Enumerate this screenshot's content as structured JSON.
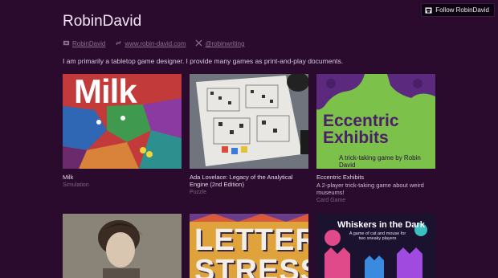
{
  "follow_button": {
    "label": "Follow RobinDavid",
    "icon": "follow-icon"
  },
  "profile": {
    "name": "RobinDavid",
    "links": [
      {
        "icon": "itchio-icon",
        "text": "RobinDavid"
      },
      {
        "icon": "link-icon",
        "text": "www.robin-david.com"
      },
      {
        "icon": "x-twitter-icon",
        "text": "@robinwriting"
      }
    ],
    "description": "I am primarily a tabletop game designer. I provide many games as print-and-play documents."
  },
  "games": [
    {
      "title": "Milk",
      "subtitle": "",
      "genre": "Simulation",
      "cover_text": "Milk"
    },
    {
      "title": "Ada Lovelace: Legacy of the Analytical Engine (2nd Edition)",
      "subtitle": "",
      "genre": "Puzzle",
      "cover_text": ""
    },
    {
      "title": "Eccentric Exhibits",
      "subtitle": "A 2-player trick-taking game about weird museums!",
      "genre": "Card Game",
      "cover_text": "Eccentric Exhibits",
      "cover_sub": "A trick-taking game by Robin David"
    }
  ],
  "games_row2": [
    {
      "cover_text": ""
    },
    {
      "cover_text": "LETTER STRESS"
    },
    {
      "cover_text": "Whiskers in the Dark",
      "cover_sub": "A game of cat and mouse for two sneaky players"
    }
  ],
  "colors": {
    "background": "#2a0b2e",
    "text": "#e9d9ec",
    "muted": "#8c6f91"
  }
}
